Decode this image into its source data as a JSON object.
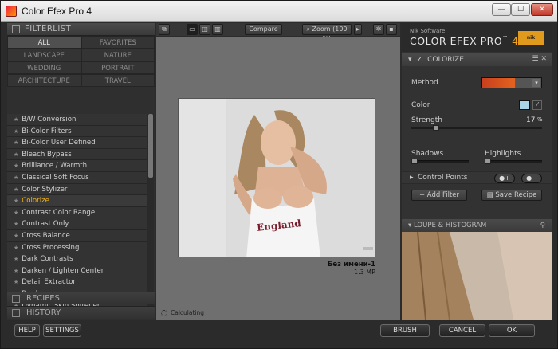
{
  "window": {
    "title": "Color Efex Pro 4",
    "minimize": "—",
    "maximize": "☐",
    "close": "✕"
  },
  "filterlist": {
    "header": "FILTERLIST",
    "categories": [
      "ALL",
      "FAVORITES",
      "LANDSCAPE",
      "NATURE",
      "WEDDING",
      "PORTRAIT",
      "ARCHITECTURE",
      "TRAVEL"
    ],
    "items": [
      "B/W Conversion",
      "Bi-Color Filters",
      "Bi-Color User Defined",
      "Bleach Bypass",
      "Brilliance / Warmth",
      "Classical Soft Focus",
      "Color Stylizer",
      "Colorize",
      "Contrast Color Range",
      "Contrast Only",
      "Cross Balance",
      "Cross Processing",
      "Dark Contrasts",
      "Darken / Lighten Center",
      "Detail Extractor",
      "Duplex",
      "Dynamic Skin Softener"
    ],
    "star": "★"
  },
  "panels": {
    "recipes": "RECIPES",
    "history": "HISTORY"
  },
  "toolbar": {
    "compare": "Compare",
    "zoom": "Zoom (100 %)"
  },
  "preview": {
    "image_title": "Без имени-1",
    "image_size": "1.3 MP",
    "status": "Calculating",
    "shirt_text": "England"
  },
  "brand": {
    "company": "Nik Software",
    "product": "COLOR EFEX PRO",
    "tm": "™",
    "version": "4",
    "logo": "nik"
  },
  "colorize": {
    "filter_name": "COLORIZE",
    "method_label": "Method",
    "color_label": "Color",
    "strength_label": "Strength",
    "strength_value": "17",
    "strength_unit": "%",
    "strength_fraction": 0.17,
    "shadows_label": "Shadows",
    "highlights_label": "Highlights",
    "control_points_label": "Control Points",
    "add_filter": "Add Filter",
    "save_recipe": "Save Recipe",
    "swatch_color": "#a9d6e6"
  },
  "loupe": {
    "header": "LOUPE & HISTOGRAM"
  },
  "bottombar": {
    "help": "HELP",
    "settings": "SETTINGS",
    "brush": "BRUSH",
    "cancel": "CANCEL",
    "ok": "OK"
  },
  "colors": {
    "selected_filter": "#f3b215",
    "accent": "#e3621f"
  }
}
